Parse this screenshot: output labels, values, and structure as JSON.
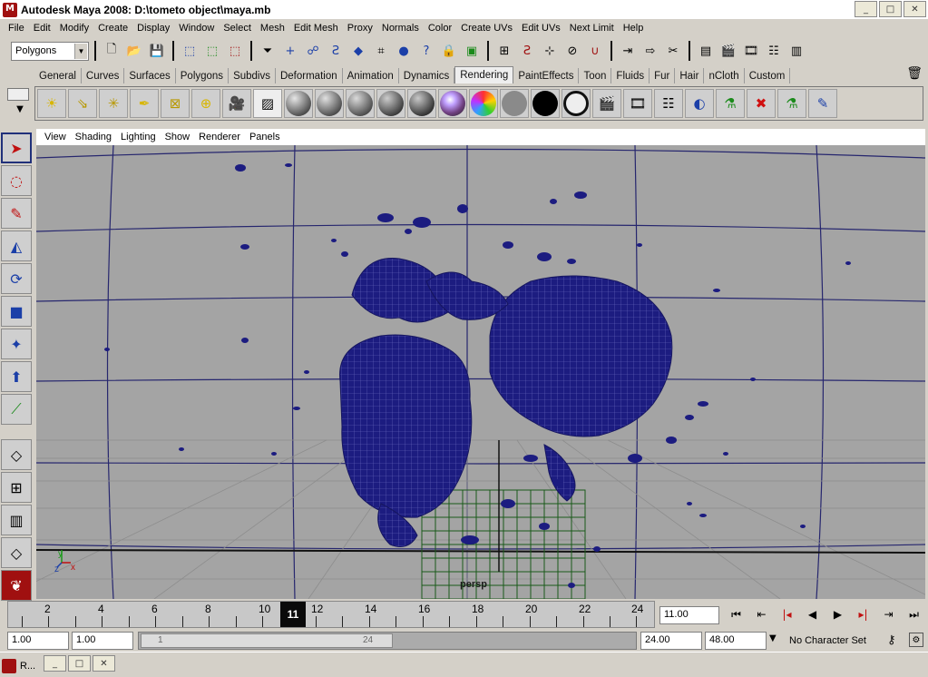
{
  "window": {
    "title": "Autodesk Maya 2008: D:\\tometo object\\maya.mb",
    "min": "_",
    "max": "□",
    "close": "✕"
  },
  "menu": [
    "File",
    "Edit",
    "Modify",
    "Create",
    "Display",
    "Window",
    "Select",
    "Mesh",
    "Edit Mesh",
    "Proxy",
    "Normals",
    "Color",
    "Create UVs",
    "Edit UVs",
    "Next Limit",
    "Help"
  ],
  "status_line": {
    "mode": "Polygons"
  },
  "shelf_tabs": [
    "General",
    "Curves",
    "Surfaces",
    "Polygons",
    "Subdivs",
    "Deformation",
    "Animation",
    "Dynamics",
    "Rendering",
    "PaintEffects",
    "Toon",
    "Fluids",
    "Fur",
    "Hair",
    "nCloth",
    "Custom"
  ],
  "active_shelf_tab": "Rendering",
  "panel_menu": [
    "View",
    "Shading",
    "Lighting",
    "Show",
    "Renderer",
    "Panels"
  ],
  "viewport": {
    "camera_label": "persp",
    "axis_labels": {
      "y": "y",
      "z": "z",
      "x": "x"
    },
    "background": "#a4a4a4",
    "wire_color": "#1a1a78"
  },
  "timeline": {
    "labels": [
      "2",
      "4",
      "6",
      "8",
      "10",
      "12",
      "14",
      "16",
      "18",
      "20",
      "22",
      "24"
    ],
    "current_frame": "11",
    "current_time": "11.00"
  },
  "range": {
    "start_time": "1.00",
    "playback_start": "1.00",
    "playback_end": "24.00",
    "end_time": "48.00",
    "slider_start": "1",
    "slider_end": "24"
  },
  "character_set": "No Character Set",
  "taskbar": {
    "item": "R..."
  }
}
